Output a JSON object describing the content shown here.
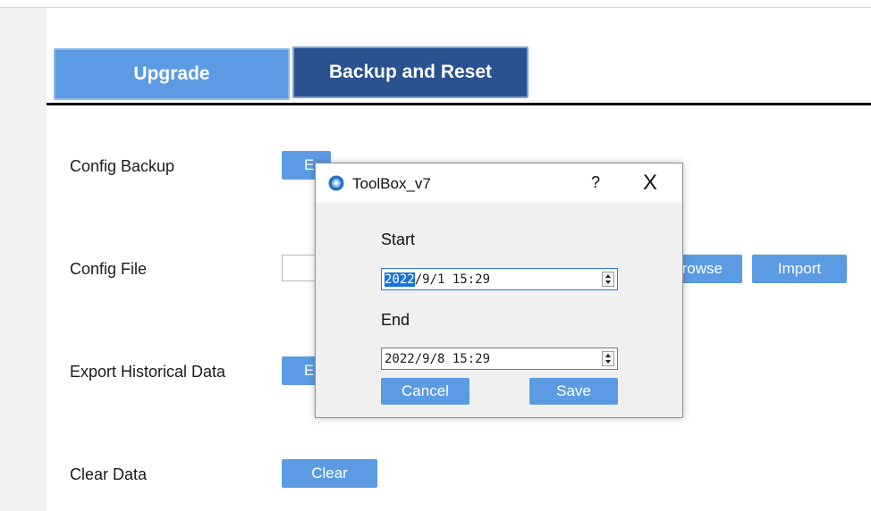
{
  "tabs": {
    "upgrade": "Upgrade",
    "backup_reset": "Backup and Reset"
  },
  "rows": {
    "config_backup": {
      "label": "Config Backup",
      "button": "E"
    },
    "config_file": {
      "label": "Config File",
      "browse": "rowse",
      "import": "Import"
    },
    "export_historical": {
      "label": "Export Historical Data",
      "button": "E"
    },
    "clear_data": {
      "label": "Clear Data",
      "button": "Clear"
    }
  },
  "dialog": {
    "title": "ToolBox_v7",
    "help": "?",
    "close": "X",
    "icon": "toolbox-app-icon",
    "start_label": "Start",
    "start_year": "2022",
    "start_rest": "/9/1 15:29",
    "end_label": "End",
    "end_value": "2022/9/8 15:29",
    "cancel": "Cancel",
    "save": "Save"
  },
  "colors": {
    "button_blue": "#5b9be3",
    "active_tab": "#2a5190",
    "selection": "#1a74d6"
  }
}
